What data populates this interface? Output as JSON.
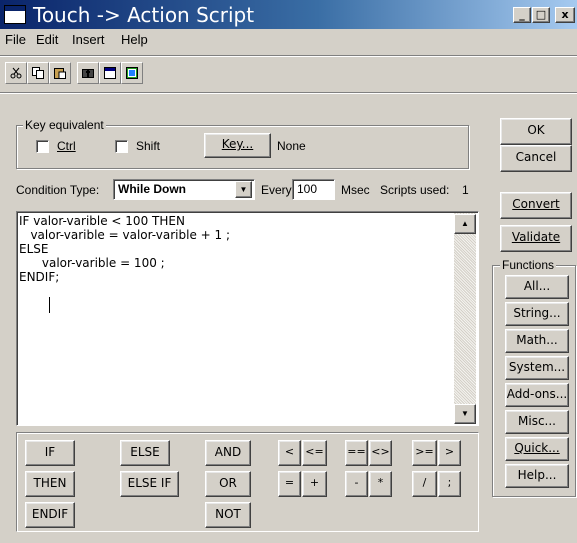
{
  "window": {
    "title": "Touch -> Action Script",
    "controls": {
      "minimize": "_",
      "maximize": "□",
      "close": "x"
    }
  },
  "menu": [
    {
      "label": "File"
    },
    {
      "label": "Edit"
    },
    {
      "label": "Insert"
    },
    {
      "label": "Help"
    }
  ],
  "toolbar": {
    "icons": [
      "cut-icon",
      "copy-icon",
      "paste-icon",
      "find-icon",
      "window-icon",
      "image-icon"
    ]
  },
  "key_equivalent": {
    "legend": "Key equivalent",
    "ctrl_label": "Ctrl",
    "shift_label": "Shift",
    "key_button": "Key...",
    "key_value": "None"
  },
  "condition": {
    "label": "Condition Type:",
    "type_value": "While Down",
    "every_label": "Every",
    "every_value": "100",
    "msec_label": "Msec",
    "scripts_used_label": "Scripts used:",
    "scripts_used_value": "1"
  },
  "script": {
    "lines": [
      "IF valor-varible < 100 THEN",
      "   valor-varible = valor-varible + 1 ;",
      "ELSE",
      "      valor-varible = 100 ;",
      "ENDIF;"
    ]
  },
  "right_buttons": {
    "ok": "OK",
    "cancel": "Cancel",
    "convert": "Convert",
    "validate": "Validate"
  },
  "functions": {
    "legend": "Functions",
    "items": [
      "All...",
      "String...",
      "Math...",
      "System...",
      "Add-ons...",
      "Misc...",
      "Quick...",
      "Help..."
    ]
  },
  "keywords": {
    "if": "IF",
    "else": "ELSE",
    "and": "AND",
    "then": "THEN",
    "else_if": "ELSE IF",
    "or": "OR",
    "endif": "ENDIF",
    "not": "NOT"
  },
  "operators": {
    "lt": "<",
    "le": "<=",
    "eq": "==",
    "ne": "<>",
    "ge": ">=",
    "gt": ">",
    "assign": "=",
    "plus": "+",
    "minus": "-",
    "times": "*",
    "divide": "/",
    "semicolon": ";"
  }
}
